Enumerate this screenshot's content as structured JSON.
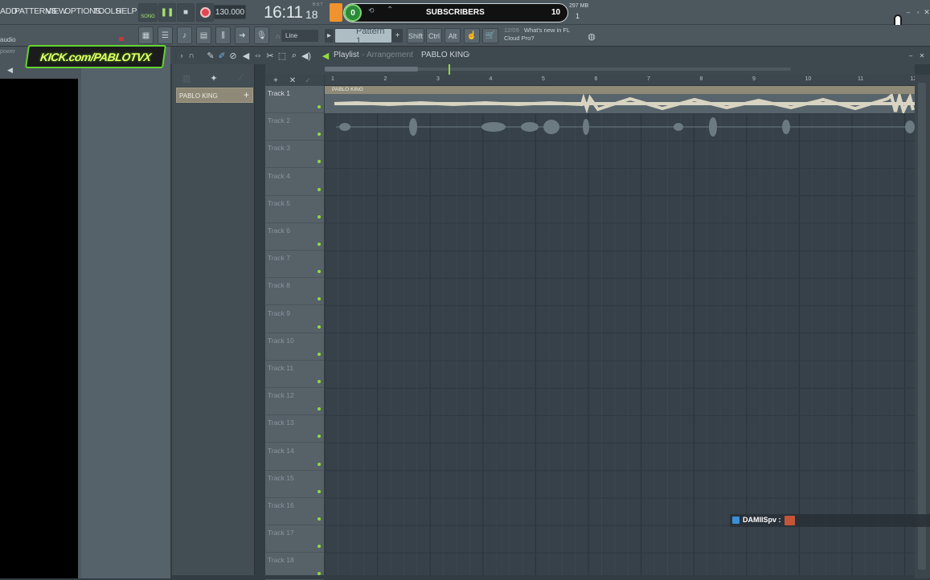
{
  "menu": [
    "ADD",
    "PATTERNS",
    "VIEW",
    "OPTIONS",
    "TOOLS",
    "HELP"
  ],
  "transport": {
    "song_label": "SONG",
    "tempo": "130.000",
    "time_main": "16:11",
    "time_sub": "18",
    "time_tag": "B:S:T"
  },
  "counter": {
    "left": "0",
    "label": "SUBSCRIBERS",
    "right": "10"
  },
  "memory": {
    "mb": "297 MB",
    "voices": "1"
  },
  "toolbar2": {
    "snap": "Line",
    "pattern": "Pattern 1",
    "shift": "Shift",
    "ctrl": "Ctrl",
    "alt": "Alt",
    "news_date": "12/09",
    "news_text1": "What's new in FL",
    "news_text2": "Cloud Pro?"
  },
  "left": {
    "audio_label": "audio",
    "power_label": "power",
    "banner": "KICK.com/PABLOTVX"
  },
  "playlist": {
    "title": "Playlist",
    "sep": "-",
    "subtitle": "Arrangement",
    "pattern_name": "PABLO KING"
  },
  "picker": {
    "item": "PABLO KING"
  },
  "clip": {
    "name": "PABLO KING"
  },
  "ruler": [
    "1",
    "2",
    "3",
    "4",
    "5",
    "6",
    "7",
    "8",
    "9",
    "10",
    "11",
    "12"
  ],
  "tracks": [
    "Track 1",
    "Track 2",
    "Track 3",
    "Track 4",
    "Track 5",
    "Track 6",
    "Track 7",
    "Track 8",
    "Track 9",
    "Track 10",
    "Track 11",
    "Track 12",
    "Track 13",
    "Track 14",
    "Track 15",
    "Track 16",
    "Track 17",
    "Track 18"
  ],
  "chat": {
    "user": "DAMIISpv :"
  },
  "colors": {
    "accent_green": "#8fdb3e",
    "record": "#e0474f",
    "orange": "#f0922d",
    "clip_header": "#8f8a77",
    "clip_wave": "#d9d4c1",
    "grid": "#36414a"
  }
}
